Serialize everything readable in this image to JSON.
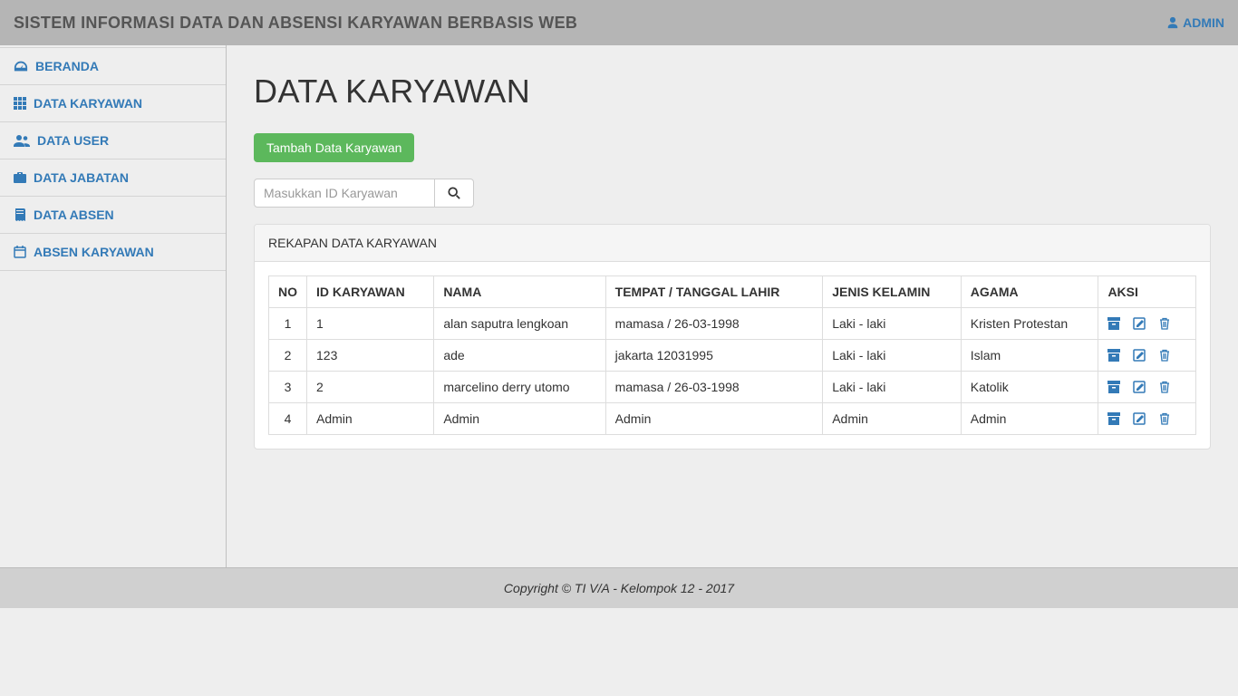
{
  "topbar": {
    "title": "SISTEM INFORMASI DATA DAN ABSENSI KARYAWAN BERBASIS WEB",
    "user_label": "ADMIN"
  },
  "sidebar": {
    "items": [
      {
        "label": "BERANDA",
        "icon": "dashboard"
      },
      {
        "label": "DATA KARYAWAN",
        "icon": "grid"
      },
      {
        "label": "DATA USER",
        "icon": "users"
      },
      {
        "label": "DATA JABATAN",
        "icon": "briefcase"
      },
      {
        "label": "DATA ABSEN",
        "icon": "book"
      },
      {
        "label": "ABSEN KARYAWAN",
        "icon": "calendar"
      }
    ]
  },
  "page": {
    "title": "DATA KARYAWAN",
    "add_button": "Tambah Data Karyawan",
    "search_placeholder": "Masukkan ID Karyawan"
  },
  "panel": {
    "title": "REKAPAN DATA KARYAWAN",
    "columns": [
      "NO",
      "ID KARYAWAN",
      "NAMA",
      "TEMPAT / TANGGAL LAHIR",
      "JENIS KELAMIN",
      "AGAMA",
      "AKSI"
    ],
    "rows": [
      {
        "no": "1",
        "id": "1",
        "nama": "alan saputra lengkoan",
        "ttl": "mamasa / 26-03-1998",
        "jk": "Laki - laki",
        "agama": "Kristen Protestan"
      },
      {
        "no": "2",
        "id": "123",
        "nama": "ade",
        "ttl": "jakarta 12031995",
        "jk": "Laki - laki",
        "agama": "Islam"
      },
      {
        "no": "3",
        "id": "2",
        "nama": "marcelino derry utomo",
        "ttl": "mamasa / 26-03-1998",
        "jk": "Laki - laki",
        "agama": "Katolik"
      },
      {
        "no": "4",
        "id": "Admin",
        "nama": "Admin",
        "ttl": "Admin",
        "jk": "Admin",
        "agama": "Admin"
      }
    ]
  },
  "footer": {
    "text": "Copyright © TI V/A - Kelompok 12 - 2017"
  }
}
